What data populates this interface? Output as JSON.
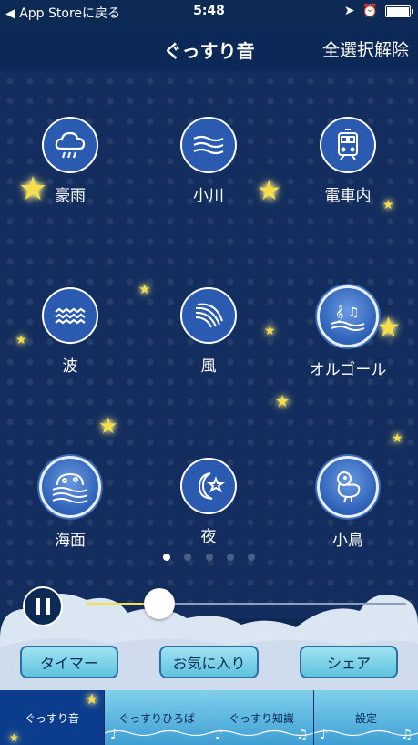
{
  "status_bar": {
    "back_text": "◀ App Storeに戻る",
    "time": "5:48"
  },
  "nav": {
    "title": "ぐっすり音",
    "action": "全選択解除"
  },
  "sounds": [
    {
      "label": "豪雨",
      "icon": "rain-cloud-icon"
    },
    {
      "label": "小川",
      "icon": "stream-waves-icon"
    },
    {
      "label": "電車内",
      "icon": "train-icon"
    },
    {
      "label": "波",
      "icon": "wave-icon"
    },
    {
      "label": "風",
      "icon": "wind-icon"
    },
    {
      "label": "オルゴール",
      "icon": "music-box-icon"
    },
    {
      "label": "海面",
      "icon": "sea-surface-icon"
    },
    {
      "label": "夜",
      "icon": "moon-star-icon"
    },
    {
      "label": "小鳥",
      "icon": "bird-icon"
    }
  ],
  "pager": {
    "pages": 5,
    "current": 1
  },
  "player": {
    "volume_fraction": 0.23
  },
  "actions": {
    "timer": "タイマー",
    "favorite": "お気に入り",
    "share": "シェア"
  },
  "tabs": [
    {
      "label": "ぐっすり音",
      "active": true
    },
    {
      "label": "ぐっすりひろば",
      "active": false
    },
    {
      "label": "ぐっすり知識",
      "active": false
    },
    {
      "label": "設定",
      "active": false
    }
  ],
  "colors": {
    "background": "#132e5e",
    "accent_yellow": "#f2e24a",
    "button_cyan": "#7fd0ec"
  }
}
